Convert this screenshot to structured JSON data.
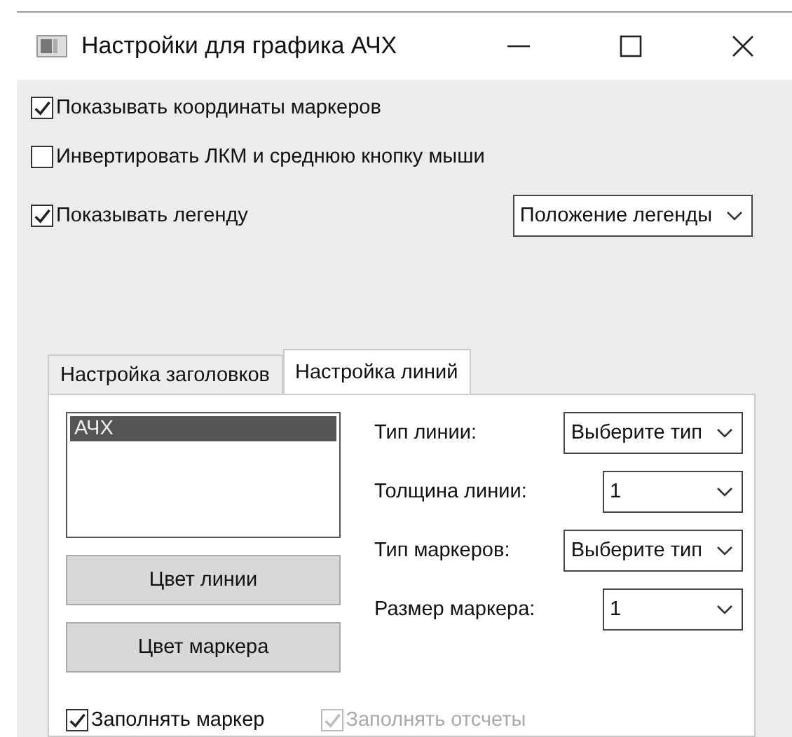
{
  "window": {
    "title": "Настройки для графика АЧХ"
  },
  "options": [
    {
      "label": "Показывать координаты маркеров",
      "checked": true
    },
    {
      "label": "Инвертировать ЛКМ и среднюю кнопку мыши",
      "checked": false
    },
    {
      "label": "Показывать легенду",
      "checked": true
    }
  ],
  "legend_position": {
    "value": "Положение легенды"
  },
  "tabs": [
    {
      "label": "Настройка заголовков",
      "selected": false
    },
    {
      "label": "Настройка линий",
      "selected": true
    }
  ],
  "series_list": [
    {
      "label": "АЧХ",
      "selected": true
    }
  ],
  "buttons": [
    "Цвет линии",
    "Цвет маркера"
  ],
  "fields": [
    {
      "label": "Тип линии:",
      "value": "Выберите тип"
    },
    {
      "label": "Толщина линии:",
      "value": "1"
    },
    {
      "label": "Тип маркеров:",
      "value": "Выберите тип"
    },
    {
      "label": "Размер маркера:",
      "value": "1"
    }
  ],
  "bottom_options": [
    {
      "label": "Заполнять маркер",
      "checked": true,
      "disabled": false
    },
    {
      "label": "Заполнять отсчеты",
      "checked": true,
      "disabled": true
    }
  ]
}
